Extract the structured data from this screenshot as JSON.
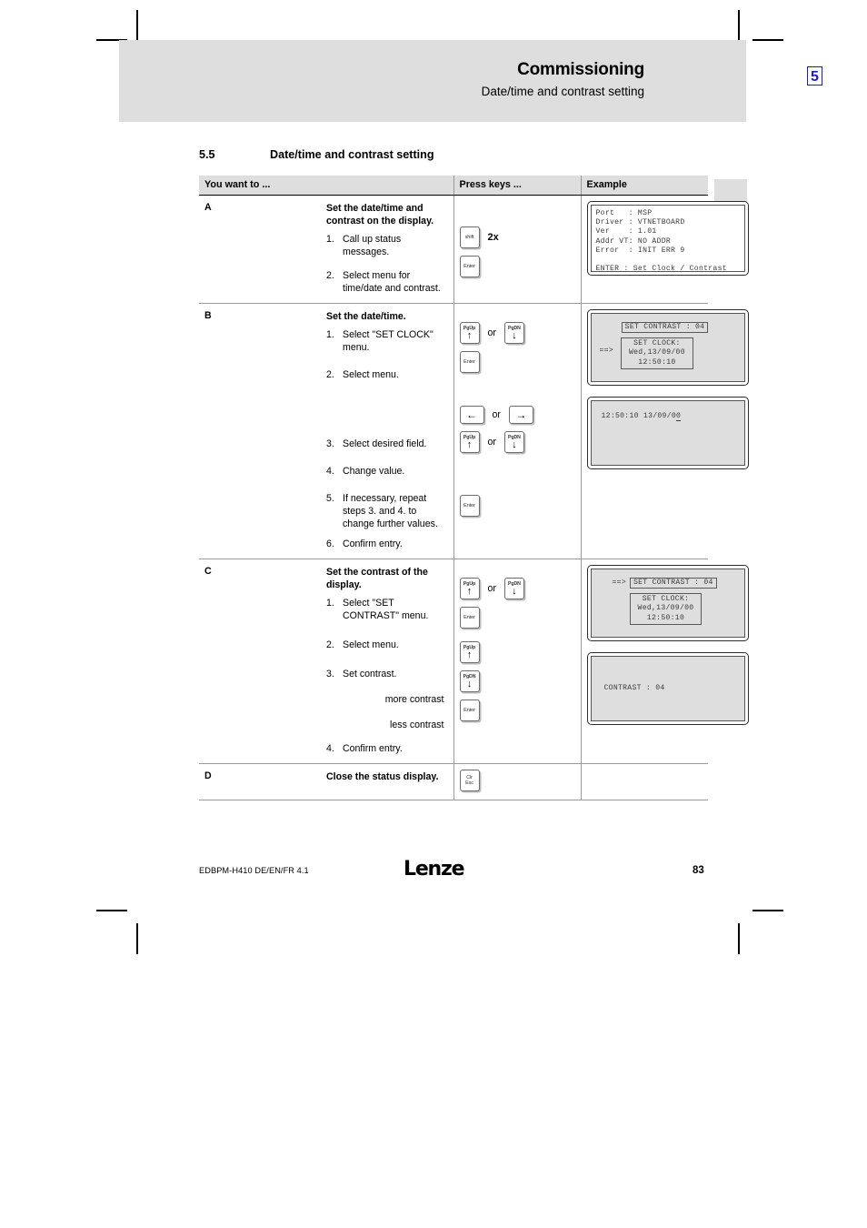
{
  "header": {
    "title": "Commissioning",
    "subtitle": "Date/time and contrast setting",
    "chapter": "5"
  },
  "section": {
    "number": "5.5",
    "title": "Date/time and contrast setting"
  },
  "table": {
    "columns": {
      "want": "You want to ...",
      "keys": "Press keys ...",
      "example": "Example"
    },
    "rows": [
      {
        "letter": "A",
        "title": "Set the date/time and contrast on the display.",
        "steps": [
          "Call up status messages.",
          "Select menu for time/date and contrast."
        ],
        "keys": [
          {
            "cap": "shift",
            "multiplier": "2x"
          },
          {
            "cap": "Enter"
          }
        ]
      },
      {
        "letter": "B",
        "title": "Set the date/time.",
        "steps": [
          "Select \"SET CLOCK\" menu.",
          "Select menu.",
          "Select desired field.",
          "Change value.",
          "If necessary, repeat steps 3. and 4. to change further values.",
          "Confirm entry."
        ],
        "keys": [
          {
            "cap_top": "PgUp",
            "arrow": "↑",
            "or": "or",
            "cap_top2": "PgDN",
            "arrow2": "↓"
          },
          {
            "cap": "Enter"
          },
          {
            "arrow_h": "←",
            "or": "or",
            "arrow_h2": "→"
          },
          {
            "cap_top": "PgUp",
            "arrow": "↑",
            "or": "or",
            "cap_top2": "PgDN",
            "arrow2": "↓"
          },
          {
            "cap": "Enter"
          }
        ]
      },
      {
        "letter": "C",
        "title": "Set the contrast of the display.",
        "steps": [
          "Select \"SET CONTRAST\" menu.",
          "Select menu.",
          "Set contrast.",
          "Confirm entry."
        ],
        "labels": {
          "more": "more contrast",
          "less": "less contrast"
        }
      },
      {
        "letter": "D",
        "title": "Close the status display.",
        "key": {
          "line1": "Clr",
          "line2": "Esc"
        }
      }
    ]
  },
  "keycaps": {
    "shift": "shift",
    "enter": "Enter",
    "pgup": "PgUp",
    "pgdn": "PgDN",
    "arrow_up": "↑",
    "arrow_down": "↓",
    "arrow_left": "←",
    "arrow_right": "→",
    "multiplier_2x": "2x",
    "or": "or",
    "clr": "Clr",
    "esc": "Esc"
  },
  "lcd": {
    "panel_a": "Port   : MSP\nDriver : VTNETBOARD\nVer    : 1.01\nAddr VT: NO ADDR\nError  : INIT ERR 9\n\nENTER : Set Clock / Contrast",
    "panel_b": {
      "contrast_line": "SET CONTRAST : 04",
      "arrow": "==>",
      "clock_title": "SET CLOCK:",
      "clock_date": "Wed,13/09/00",
      "clock_time": "12:50:10"
    },
    "panel_c": {
      "time_date": "12:50:10 13/09/0",
      "cursor_char": "0"
    },
    "panel_d": {
      "arrow": "==>",
      "contrast_line": "SET CONTRAST : 04",
      "clock_title": "SET CLOCK:",
      "clock_date": "Wed,13/09/00",
      "clock_time": "12:50:10"
    },
    "panel_e": {
      "contrast_value": "CONTRAST : 04"
    }
  },
  "footer": {
    "document": "EDBPM-H410 DE/EN/FR 4.1",
    "logo": "Lenze",
    "page": "83"
  }
}
